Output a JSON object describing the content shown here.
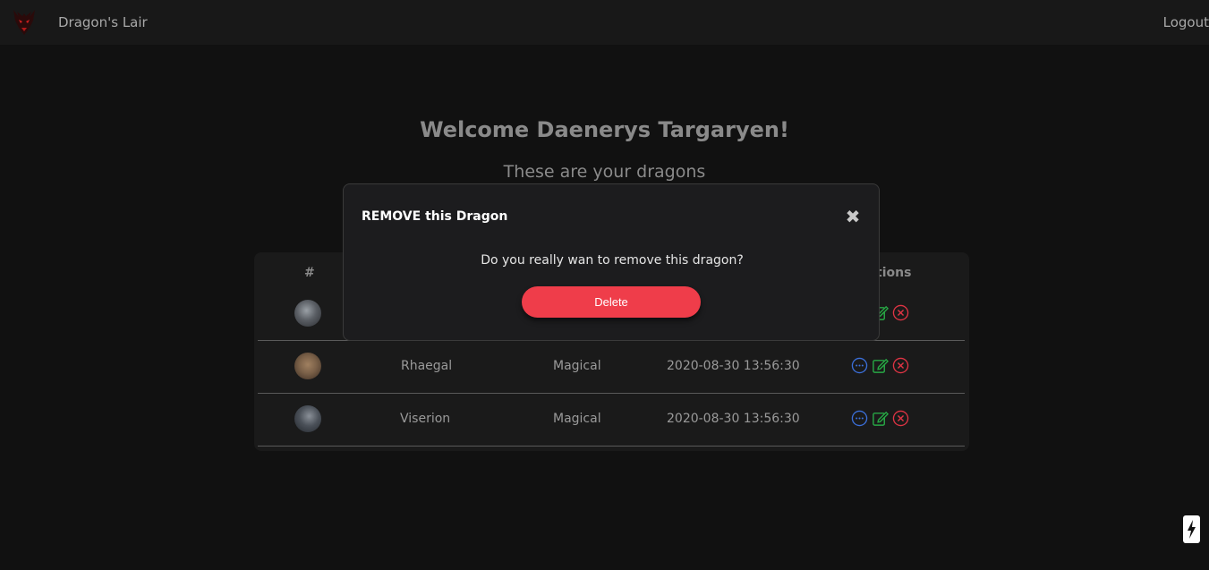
{
  "navbar": {
    "brand": "Dragon's Lair",
    "logout": "Logout",
    "logo_icon": "dragon-logo-icon"
  },
  "header": {
    "welcome": "Welcome Daenerys Targaryen!",
    "subtitle": "These are your dragons"
  },
  "table": {
    "headers": [
      "#",
      "tions"
    ],
    "rows": [
      {
        "name": "",
        "type": "",
        "date": "",
        "avatar_color": "#5a5e64"
      },
      {
        "name": "Rhaegal",
        "type": "Magical",
        "date": "2020-08-30 13:56:30",
        "avatar_color": "#7a6048"
      },
      {
        "name": "Viserion",
        "type": "Magical",
        "date": "2020-08-30 13:56:30",
        "avatar_color": "#4a5058"
      }
    ]
  },
  "modal": {
    "title": "REMOVE this Dragon",
    "body": "Do you really wan to remove this dragon?",
    "delete_label": "Delete"
  },
  "colors": {
    "background": "#111111",
    "navbar": "#181818",
    "danger": "#ef3d4a",
    "info": "#3b6fd9",
    "success": "#28a745"
  }
}
